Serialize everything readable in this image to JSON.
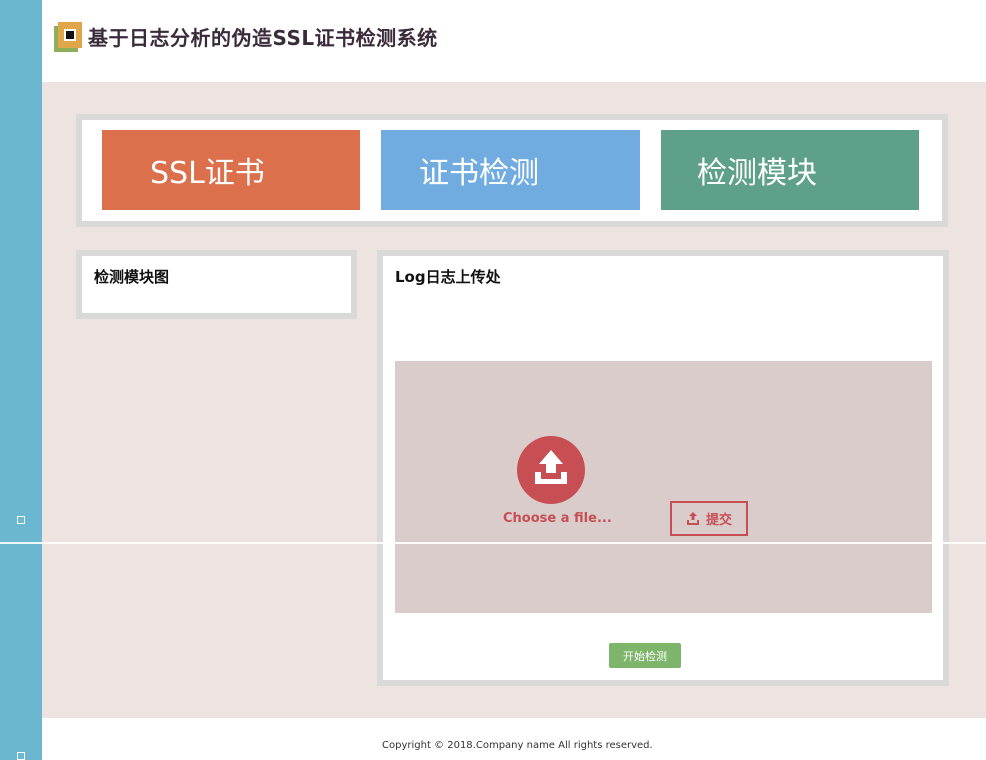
{
  "app": {
    "title": "基于日志分析的伪造SSL证书检测系统"
  },
  "nav": {
    "items": [
      {
        "label": "SSL证书",
        "color": "#dc704d"
      },
      {
        "label": "证书检测",
        "color": "#71ace0"
      },
      {
        "label": "检测模块",
        "color": "#5fa08a"
      }
    ]
  },
  "panels": {
    "module_diagram_title": "检测模块图",
    "upload_title": "Log日志上传处"
  },
  "upload": {
    "choose_label": "Choose a file...",
    "submit_label": "提交",
    "start_label": "开始检测",
    "icon": "upload-icon",
    "submit_icon": "upload-small-icon"
  },
  "footer": {
    "copyright": "Copyright © 2018.Company name All rights reserved."
  },
  "colors": {
    "sidebar": "#6cb7d0",
    "accent_red": "#c74f54",
    "start_green": "#7db56a",
    "background": "#ede4e2"
  }
}
